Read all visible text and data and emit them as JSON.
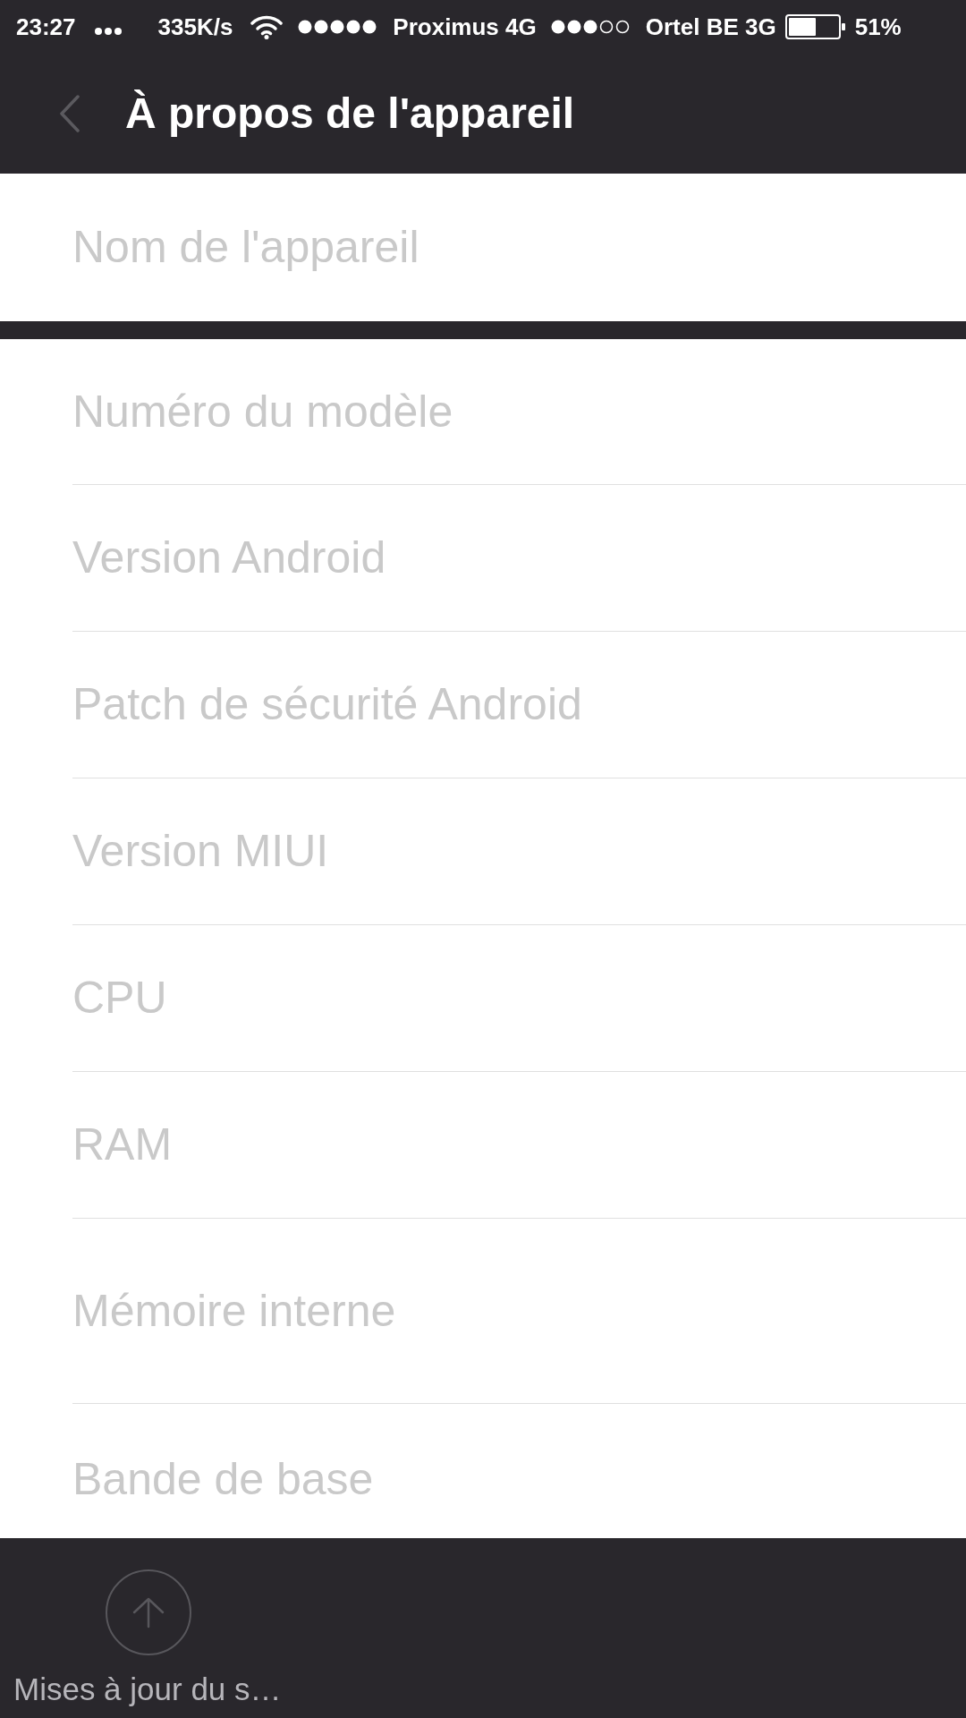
{
  "status_bar": {
    "time": "23:27",
    "speed": "335K/s",
    "carriers": [
      {
        "name": "Proximus 4G"
      },
      {
        "name": "Ortel BE 3G"
      }
    ],
    "battery": "51%"
  },
  "header": {
    "title": "À propos de l'appareil"
  },
  "device_name": {
    "label": "Nom de l'appareil"
  },
  "items": [
    {
      "label": "Numéro du modèle"
    },
    {
      "label": "Version Android"
    },
    {
      "label": "Patch de sécurité Android"
    },
    {
      "label": "Version MIUI"
    },
    {
      "label": "CPU"
    },
    {
      "label": "RAM"
    },
    {
      "label": "Mémoire interne"
    },
    {
      "label": "Bande de base"
    }
  ],
  "bottom_bar": {
    "label": "Mises à jour du s…"
  }
}
